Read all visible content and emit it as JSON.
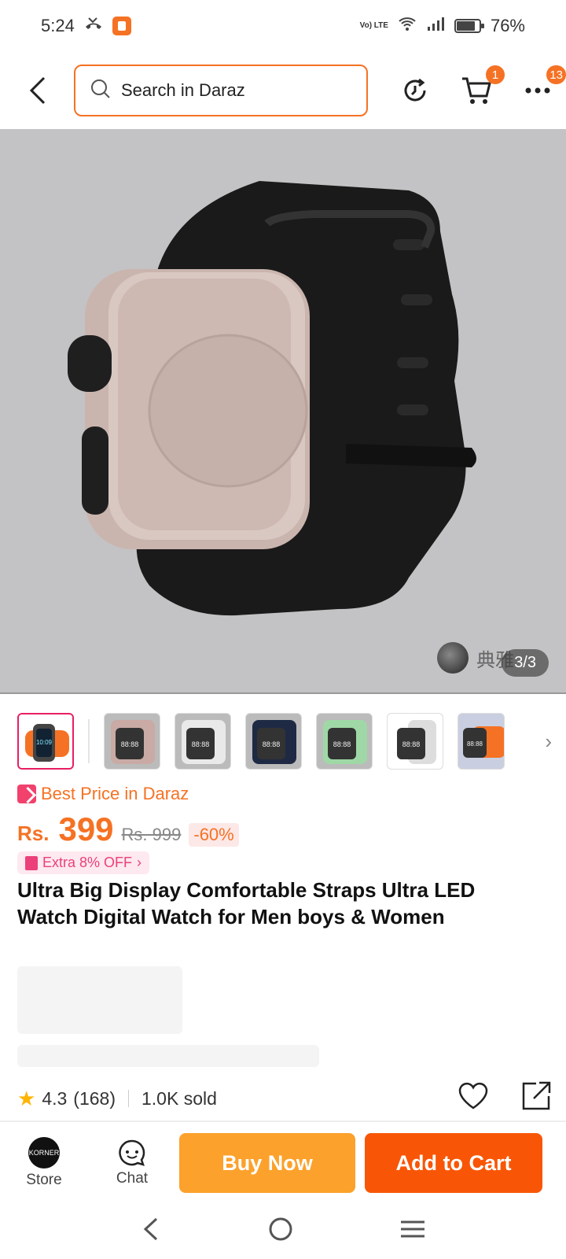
{
  "status_bar": {
    "time": "5:24",
    "network": "Vo) LTE",
    "battery": "76%"
  },
  "search": {
    "placeholder": "Search in Daraz"
  },
  "nav": {
    "cart_badge": "1",
    "more_badge": "13"
  },
  "gallery": {
    "counter": "3/3",
    "watermark": "典雅",
    "thumbnails": [
      "orange",
      "pink",
      "white",
      "navy",
      "green",
      "silver",
      "orange-2"
    ]
  },
  "pricing": {
    "best_price_label": "Best Price in Daraz",
    "currency": "Rs.",
    "price": "399",
    "original_price": "Rs. 999",
    "discount": "-60%",
    "extra_offer": "Extra 8% OFF"
  },
  "product": {
    "title": "Ultra Big Display Comfortable Straps Ultra LED Watch Digital Watch for Men boys & Women"
  },
  "rating": {
    "score": "4.3",
    "count": "(168)",
    "sold": "1.0K sold"
  },
  "actions": {
    "store_label": "Store",
    "store_logo_text": "KORNER",
    "chat_label": "Chat",
    "buy_now": "Buy Now",
    "add_to_cart": "Add to Cart"
  },
  "colors": {
    "brand_orange": "#f57224",
    "buy_now_bg": "#fca12b",
    "add_to_cart_bg": "#f85606"
  }
}
